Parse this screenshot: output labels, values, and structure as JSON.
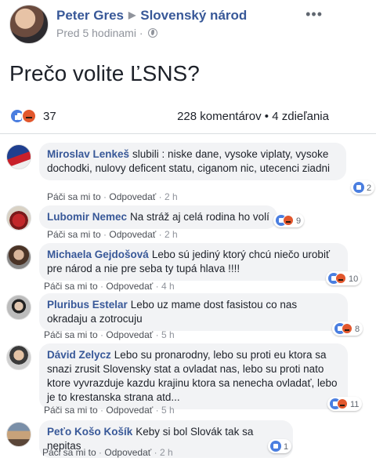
{
  "post": {
    "author": "Peter Gres",
    "target": "Slovenský národ",
    "time": "Pred 5 hodinami",
    "text": "Prečo volite ĽSNS?",
    "reaction_count": "37",
    "comments_shares": "228 komentárov • 4 zdieľania"
  },
  "labels": {
    "like": "Páči sa mi to",
    "reply": "Odpovedať",
    "separator": "·"
  },
  "comments": [
    {
      "name": "Miroslav Lenkeš",
      "text": "slubili : niske dane, vysoke viplaty, vysoke dochodki, nulovy deficent statu, ciganom nic, utecenci ziadni",
      "time": "2 h",
      "reactions": "2"
    },
    {
      "name": "Lubomir Nemec",
      "text": "Na stráž aj celá rodina ho volí",
      "time": "2 h",
      "reactions": "9"
    },
    {
      "name": "Michaela Gejdošová",
      "text": "Lebo sú jediný ktorý chcú niečo urobiť pre národ a nie pre seba ty tupá hlava !!!!",
      "time": "4 h",
      "reactions": "10"
    },
    {
      "name": "Pluribus Estelar",
      "text": "Lebo uz mame dost fasistou co nas okradaju a zotrocuju",
      "time": "5 h",
      "reactions": "8"
    },
    {
      "name": "Dávid Zelycz",
      "text": "Lebo su pronarodny, lebo su proti eu ktora sa snazi zrusit Slovensky stat a ovladat nas, lebo su proti nato ktore vyvrazduje kazdu krajinu ktora sa nenecha ovladať, lebo je to krestanska strana atd...",
      "time": "5 h",
      "reactions": "11"
    },
    {
      "name": "Peťo Košo Košík",
      "text": "Keby si bol Slovák tak sa nepitas",
      "time": "2 h",
      "reactions": "1"
    }
  ]
}
